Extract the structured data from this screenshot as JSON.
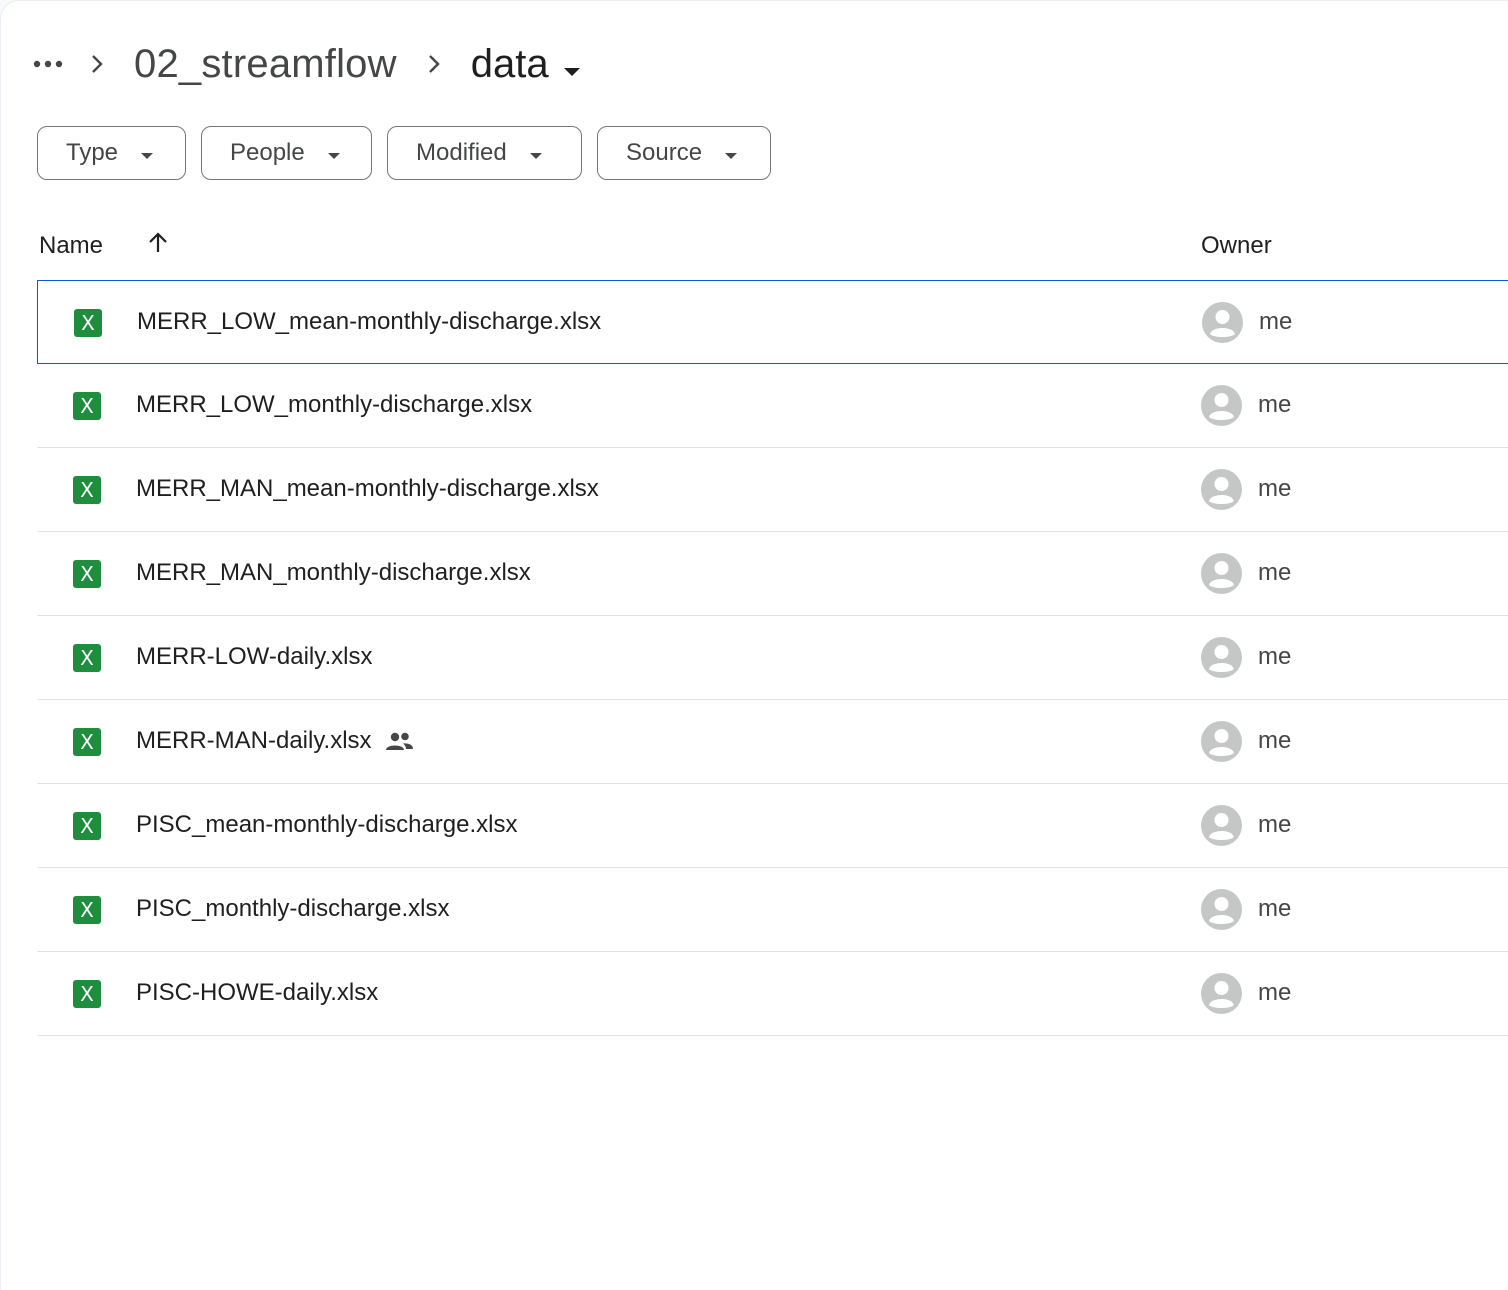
{
  "breadcrumb": {
    "more_icon": "more-horiz-icon",
    "separator_icon": "chevron-right-icon",
    "parent_folder": "02_streamflow",
    "current_folder": "data"
  },
  "filters": [
    {
      "label": "Type"
    },
    {
      "label": "People"
    },
    {
      "label": "Modified"
    },
    {
      "label": "Source"
    }
  ],
  "table": {
    "columns": {
      "name": "Name",
      "owner": "Owner"
    },
    "sort": "arrow-upward-icon",
    "rows": [
      {
        "name": "MERR_LOW_mean-monthly-discharge.xlsx",
        "owner": "me",
        "selected": true
      },
      {
        "name": "MERR_LOW_monthly-discharge.xlsx",
        "owner": "me"
      },
      {
        "name": "MERR_MAN_mean-monthly-discharge.xlsx",
        "owner": "me"
      },
      {
        "name": "MERR_MAN_monthly-discharge.xlsx",
        "owner": "me"
      },
      {
        "name": "MERR-LOW-daily.xlsx",
        "owner": "me"
      },
      {
        "name": "MERR-MAN-daily.xlsx",
        "owner": "me",
        "shared": true
      },
      {
        "name": "PISC_mean-monthly-discharge.xlsx",
        "owner": "me"
      },
      {
        "name": "PISC_monthly-discharge.xlsx",
        "owner": "me"
      },
      {
        "name": "PISC-HOWE-daily.xlsx",
        "owner": "me"
      }
    ]
  },
  "icons": {
    "file_icon": "X",
    "file_icon_color": "#1e8e3e",
    "selected_border_color": "#0b57d0"
  }
}
